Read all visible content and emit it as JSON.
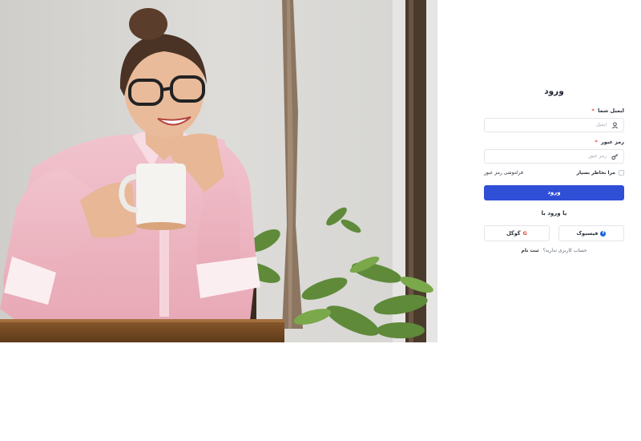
{
  "login": {
    "title": "ورود",
    "email_label": "ایمیل شما",
    "email_placeholder": "ایمیل",
    "password_label": "رمز عبور",
    "password_placeholder": "رمز عبور",
    "required_mark": "*",
    "remember_label": "مرا بخاطر بسپار",
    "forgot_link": "فراموشی رمز عبور",
    "submit_label": "ورود",
    "or_text": "یا ورود با",
    "facebook_label": "فیسبوک",
    "facebook_icon": "f",
    "google_label": "گوگل",
    "google_icon": "G",
    "signup_prompt": "حساب کاربری ندارید؟",
    "signup_link": "ثبت نام"
  },
  "colors": {
    "primary": "#2e4fd6",
    "facebook": "#1b63e2",
    "google": "#ea4335",
    "required": "#e0393e"
  },
  "icons": {
    "email": "user-icon",
    "password": "key-icon"
  }
}
